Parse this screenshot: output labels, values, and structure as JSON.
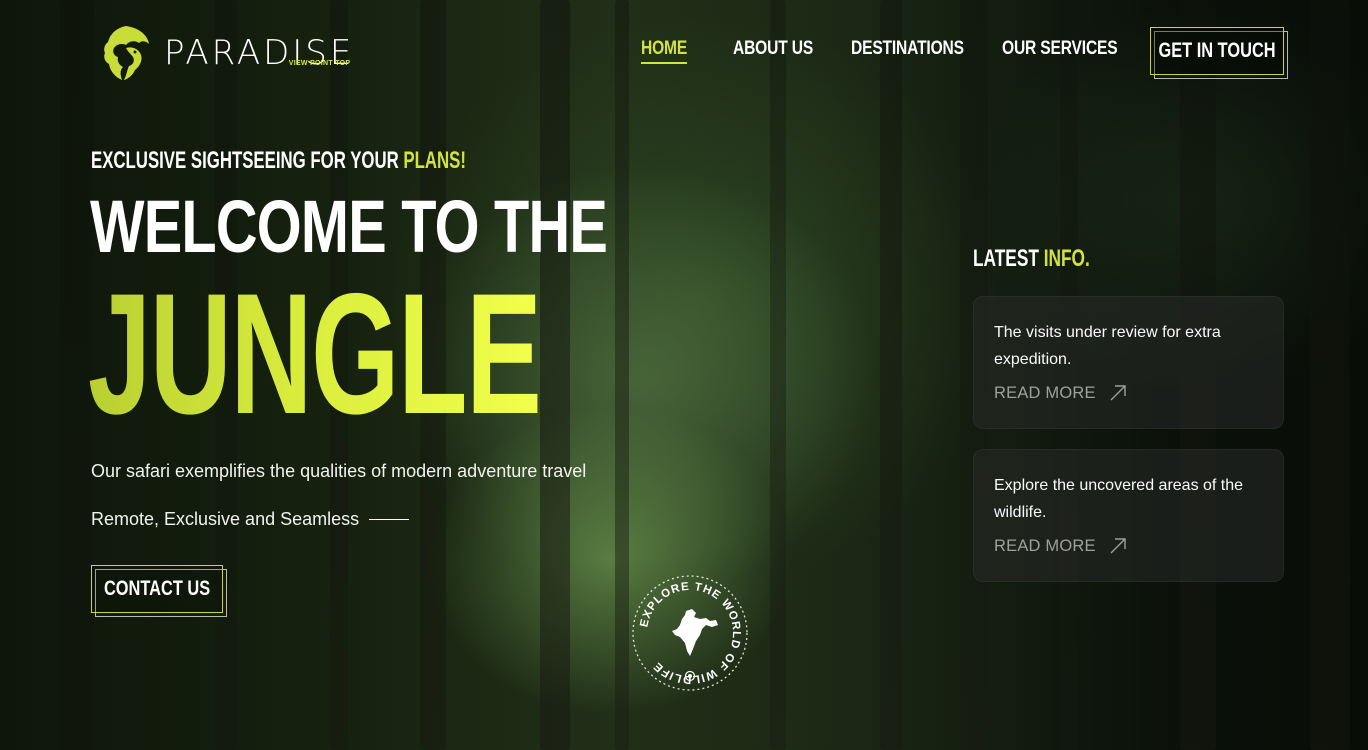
{
  "brand": {
    "name": "PARADISE",
    "tagline": "VIEW POINT TOP",
    "accent_color": "#d4e23d",
    "logo_icon": "lion-head-icon"
  },
  "nav": {
    "items": [
      {
        "label": "HOME",
        "active": true
      },
      {
        "label": "ABOUT US",
        "active": false
      },
      {
        "label": "DESTINATIONS",
        "active": false
      },
      {
        "label": "OUR SERVICES",
        "active": false
      }
    ],
    "cta_label": "GET IN TOUCH"
  },
  "hero": {
    "eyebrow_prefix": "EXCLUSIVE SIGHTSEEING FOR YOUR ",
    "eyebrow_highlight": "PLANS!",
    "title_line1": "WELCOME TO THE",
    "title_line2": "JUNGLE",
    "tagline": "Our safari exemplifies the qualities of modern adventure travel",
    "subline": "Remote, Exclusive and Seamless",
    "contact_label": "CONTACT US"
  },
  "badge": {
    "text": "EXPLORE THE WORLD OF WILDLIFE",
    "icon": "india-map-icon"
  },
  "latest": {
    "title_prefix": "LATEST ",
    "title_highlight": "INFO.",
    "cards": [
      {
        "text": "The visits under review for extra expedition.",
        "link_label": "READ MORE"
      },
      {
        "text": "Explore the uncovered areas of the wildlife.",
        "link_label": "READ MORE"
      }
    ]
  }
}
